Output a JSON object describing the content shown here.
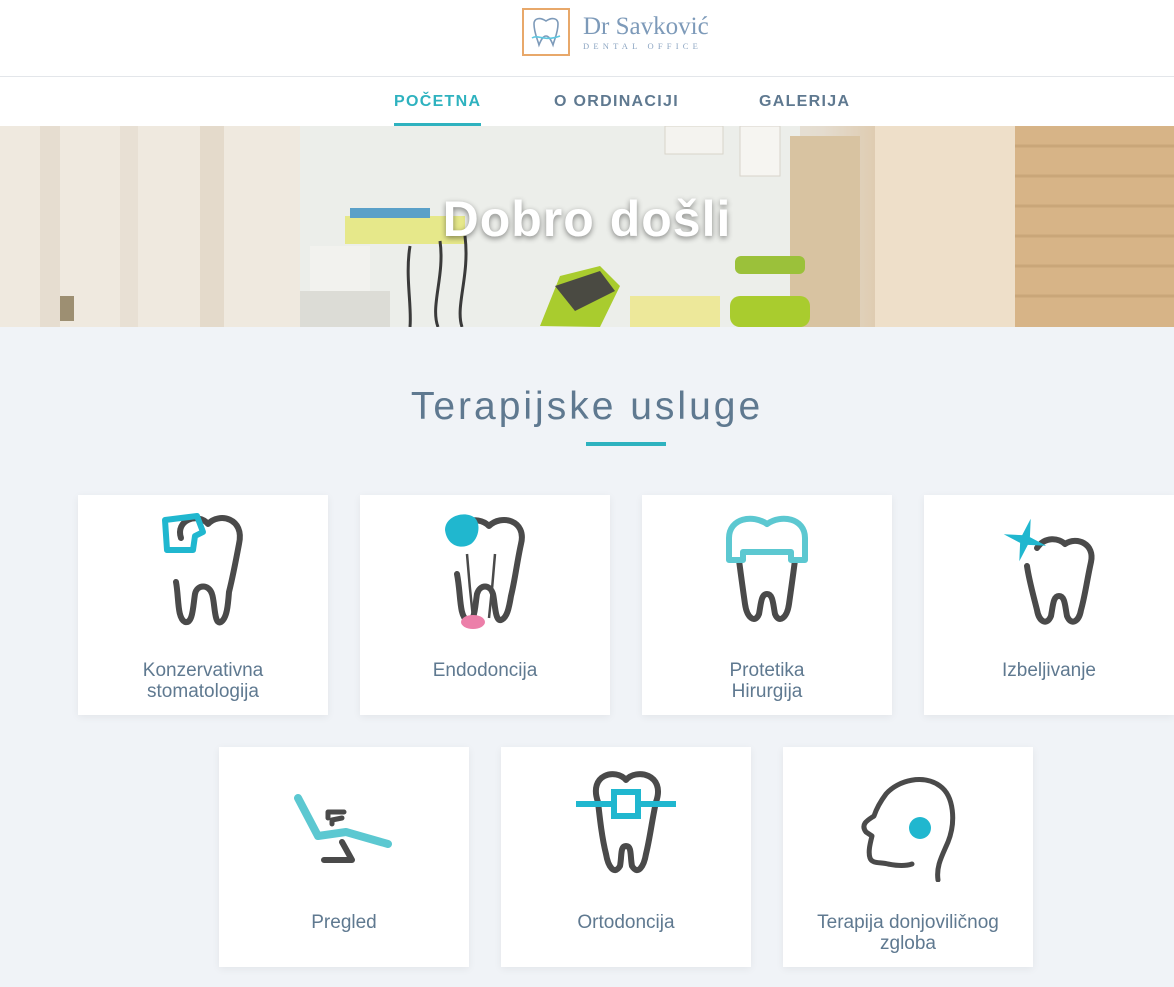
{
  "logo": {
    "name": "Dr Savković",
    "subtitle": "DENTAL OFFICE"
  },
  "nav": {
    "items": [
      {
        "label": "POČETNA",
        "active": true
      },
      {
        "label": "O ORDINACIJI",
        "active": false
      },
      {
        "label": "GALERIJA",
        "active": false
      }
    ]
  },
  "hero": {
    "title": "Dobro došli"
  },
  "services": {
    "title": "Terapijske usluge",
    "items": [
      {
        "label": "Konzervativna\nstomatologija",
        "icon": "tooth-filling-icon"
      },
      {
        "label": "Endodoncija",
        "icon": "root-canal-icon"
      },
      {
        "label": "Protetika\nHirurgija",
        "icon": "dental-crown-icon"
      },
      {
        "label": "Izbeljivanje",
        "icon": "tooth-whitening-icon"
      },
      {
        "label": "Pregled",
        "icon": "dental-chair-icon"
      },
      {
        "label": "Ortodoncija",
        "icon": "braces-icon"
      },
      {
        "label": "Terapija donjoviličnog\nzgloba",
        "icon": "jaw-joint-icon"
      }
    ]
  },
  "colors": {
    "accent": "#2eb2bf",
    "text": "#5f7990",
    "icon_dark": "#4a4a4a",
    "icon_pink": "#ec7fa9",
    "background": "#f0f3f7"
  }
}
